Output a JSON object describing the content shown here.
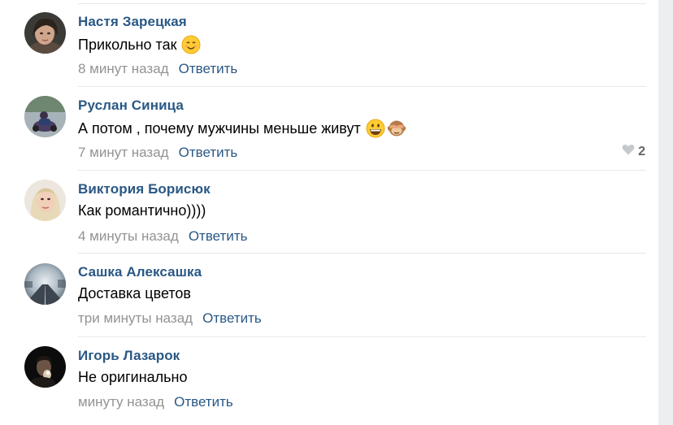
{
  "comments": [
    {
      "author": "Настя Зарецкая",
      "text": "Прикольно так",
      "emojis": [
        "smiling-face-icon"
      ],
      "time": "8 минут назад",
      "reply": "Ответить"
    },
    {
      "author": "Руслан Синица",
      "text": "А потом , почему мужчины меньше живут",
      "emojis": [
        "grinning-face-icon",
        "see-no-evil-monkey-icon"
      ],
      "time": "7 минут назад",
      "reply": "Ответить",
      "likes": "2"
    },
    {
      "author": "Виктория Борисюк",
      "text": "Как романтично))))",
      "emojis": [],
      "time": "4 минуты назад",
      "reply": "Ответить"
    },
    {
      "author": "Сашка Алексашка",
      "text": "Доставка цветов",
      "emojis": [],
      "time": "три минуты назад",
      "reply": "Ответить"
    },
    {
      "author": "Игорь Лазарок",
      "text": "Не оригинально",
      "emojis": [],
      "time": "минуту назад",
      "reply": "Ответить"
    }
  ],
  "colors": {
    "link": "#2a5885",
    "meta": "#939393",
    "divider": "#e7e8ec",
    "like_icon": "#c5c8cd"
  }
}
